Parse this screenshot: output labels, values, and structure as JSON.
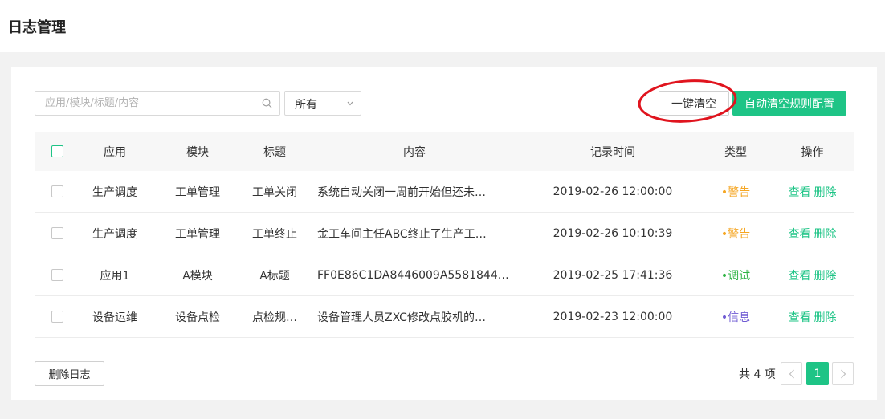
{
  "header": {
    "title": "日志管理"
  },
  "toolbar": {
    "search_placeholder": "应用/模块/标题/内容",
    "search_value": "",
    "filter_selected": "所有",
    "clear_all_label": "一键清空",
    "auto_clear_label": "自动清空规则配置"
  },
  "table": {
    "columns": [
      "应用",
      "模块",
      "标题",
      "内容",
      "记录时间",
      "类型",
      "操作"
    ],
    "rows": [
      {
        "app": "生产调度",
        "module": "工单管理",
        "title": "工单关闭",
        "content": "系统自动关闭一周前开始但还未…",
        "time": "2019-02-26 12:00:00",
        "type": "•警告",
        "type_color": "#f5a623",
        "view": "查看",
        "delete": "删除"
      },
      {
        "app": "生产调度",
        "module": "工单管理",
        "title": "工单终止",
        "content": "金工车间主任ABC终止了生产工…",
        "time": "2019-02-26 10:10:39",
        "type": "•警告",
        "type_color": "#f5a623",
        "view": "查看",
        "delete": "删除"
      },
      {
        "app": "应用1",
        "module": "A模块",
        "title": "A标题",
        "content": "FF0E86C1DA8446009A5581844…",
        "time": "2019-02-25 17:41:36",
        "type": "•调试",
        "type_color": "#2fb344",
        "view": "查看",
        "delete": "删除"
      },
      {
        "app": "设备运维",
        "module": "设备点检",
        "title": "点检规…",
        "content": "设备管理人员ZXC修改点胶机的…",
        "time": "2019-02-23 12:00:00",
        "type": "•信息",
        "type_color": "#6f5bd3",
        "view": "查看",
        "delete": "删除"
      }
    ]
  },
  "footer": {
    "delete_logs_label": "删除日志",
    "total_label": "共 4 项",
    "current_page": "1"
  },
  "colors": {
    "accent": "#1ec486",
    "annotation_ring": "#e0141e"
  }
}
